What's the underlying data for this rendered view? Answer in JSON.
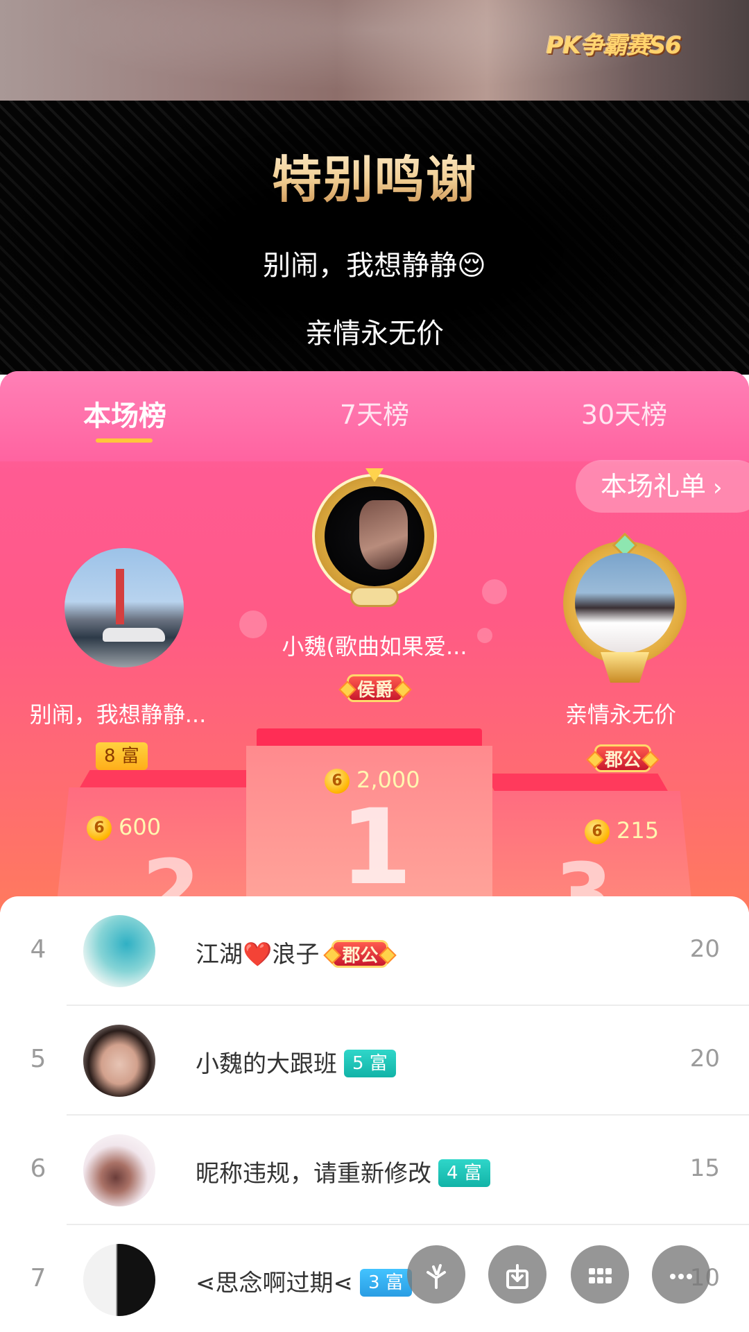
{
  "top": {
    "event_logo": "PK争霸赛S6"
  },
  "thanks": {
    "title": "特别鸣谢",
    "names": [
      "别闹，我想静静😌",
      "亲情永无价"
    ]
  },
  "tabs": [
    {
      "label": "本场榜",
      "active": true
    },
    {
      "label": "7天榜",
      "active": false
    },
    {
      "label": "30天榜",
      "active": false
    }
  ],
  "gift_list_button": "本场礼单",
  "podium": {
    "first": {
      "name": "小魏(歌曲如果爱...",
      "badge": "侯爵",
      "coins": "2,000",
      "place": "1"
    },
    "second": {
      "name": "别闹，我想静静...",
      "badge": "8 富",
      "coins": "600",
      "place": "2"
    },
    "third": {
      "name": "亲情永无价",
      "badge": "郡公",
      "coins": "215",
      "place": "3"
    }
  },
  "coin_symbol": "6",
  "ranking": [
    {
      "rank": "4",
      "name": "江湖❤️浪子",
      "badge": "郡公",
      "badge_type": "noble",
      "score": "20"
    },
    {
      "rank": "5",
      "name": "小魏的大跟班",
      "badge": "5 富",
      "badge_type": "fortune-teal",
      "score": "20"
    },
    {
      "rank": "6",
      "name": "昵称违规，请重新修改",
      "badge": "4 富",
      "badge_type": "fortune-teal",
      "score": "15"
    },
    {
      "rank": "7",
      "name": "⋖思念啊过期⋖",
      "badge": "3 富",
      "badge_type": "fortune-blue",
      "score": "10"
    }
  ],
  "actions": [
    "share-icon",
    "download-icon",
    "grid-icon",
    "more-icon"
  ],
  "colors": {
    "accent_pink": "#ff5b93",
    "underline": "#ffc63a",
    "coin": "#ffb400"
  }
}
